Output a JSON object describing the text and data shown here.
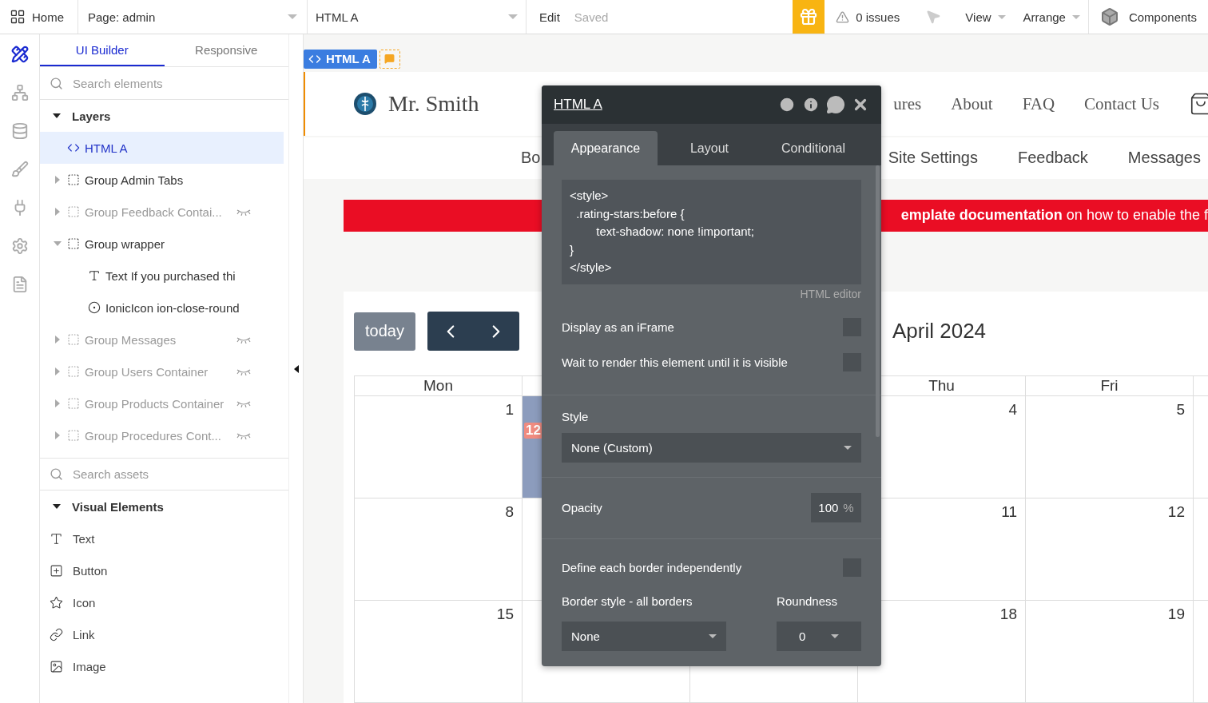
{
  "topbar": {
    "home": "Home",
    "page_selector": "Page: admin",
    "element_selector": "HTML A",
    "edit": "Edit",
    "saved": "Saved",
    "issues": "0 issues",
    "view": "View",
    "arrange": "Arrange",
    "components": "Components"
  },
  "rail": [
    {
      "kind": "design",
      "selected": true
    },
    {
      "kind": "workflow",
      "selected": false
    },
    {
      "kind": "data",
      "selected": false
    },
    {
      "kind": "styles",
      "selected": false
    },
    {
      "kind": "plugins",
      "selected": false
    },
    {
      "kind": "settings",
      "selected": false
    },
    {
      "kind": "logs",
      "selected": false
    }
  ],
  "sidebar": {
    "tabs": [
      {
        "label": "UI Builder",
        "selected": true
      },
      {
        "label": "Responsive",
        "selected": false
      }
    ],
    "search": {
      "placeholder": "Search elements"
    },
    "layers": {
      "title": "Layers",
      "expanded": true,
      "items": [
        {
          "kind": "html",
          "label": "HTML A",
          "selected": true,
          "hidden": false
        },
        {
          "kind": "group",
          "label": "Group Admin Tabs",
          "selected": false,
          "hidden": false,
          "expanded": false
        },
        {
          "kind": "group",
          "label": "Group Feedback Contai...",
          "selected": false,
          "hidden": true,
          "expanded": false
        },
        {
          "kind": "group",
          "label": "Group wrapper",
          "selected": false,
          "hidden": false,
          "expanded": true,
          "children": [
            {
              "kind": "text",
              "label": "Text If you purchased thi",
              "selected": false,
              "hidden": false
            },
            {
              "kind": "icon",
              "label": "IonicIcon ion-close-round",
              "selected": false,
              "hidden": false
            }
          ]
        },
        {
          "kind": "group",
          "label": "Group Messages",
          "selected": false,
          "hidden": true,
          "expanded": false
        },
        {
          "kind": "group",
          "label": "Group Users Container",
          "selected": false,
          "hidden": true,
          "expanded": false
        },
        {
          "kind": "group",
          "label": "Group Products Container",
          "selected": false,
          "hidden": true,
          "expanded": false
        },
        {
          "kind": "group",
          "label": "Group Procedures Cont...",
          "selected": false,
          "hidden": true,
          "expanded": false
        }
      ]
    },
    "asset_search": {
      "placeholder": "Search assets"
    },
    "visual_elements": {
      "title": "Visual Elements",
      "expanded": true,
      "items": [
        {
          "kind": "text",
          "label": "Text"
        },
        {
          "kind": "button",
          "label": "Button"
        },
        {
          "kind": "icon",
          "label": "Icon"
        },
        {
          "kind": "link",
          "label": "Link"
        },
        {
          "kind": "image",
          "label": "Image"
        }
      ]
    }
  },
  "canvas": {
    "element_tag": "HTML A",
    "site": {
      "brand": "Mr. Smith",
      "nav": [
        "ures",
        "About",
        "FAQ",
        "Contact Us"
      ],
      "subnav_left": [
        "Bo"
      ],
      "subnav_right": [
        "Site Settings",
        "Feedback",
        "Messages"
      ],
      "banner": "**emplate documentation** on how to enable the f"
    },
    "calendar": {
      "today": "today",
      "title": "April 2024",
      "headings": {
        "column_1": "Mon",
        "column_4": "Thu",
        "column_5": "Fri"
      },
      "weeks": [
        {
          "column_1": "1",
          "column_2_event": "12",
          "column_4": "4",
          "column_5": "5"
        },
        {
          "column_1": "8",
          "column_4": "11",
          "column_5": "12"
        },
        {
          "column_1": "15",
          "column_4": "18",
          "column_5": "19"
        }
      ]
    }
  },
  "property_editor": {
    "title": "HTML A",
    "tabs": [
      {
        "label": "Appearance",
        "selected": true
      },
      {
        "label": "Layout",
        "selected": false
      },
      {
        "label": "Conditional",
        "selected": false
      }
    ],
    "code": "<style>\n  .rating-stars:before {\n        text-shadow: none !important;\n}\n</style>",
    "code_label": "HTML editor",
    "options": [
      {
        "label": "Display as an iFrame",
        "checked": false
      },
      {
        "label": "Wait to render this element until it is visible",
        "checked": false
      }
    ],
    "style": {
      "label": "Style",
      "value": "None (Custom)"
    },
    "opacity": {
      "label": "Opacity",
      "value": "100",
      "unit": "%"
    },
    "border_independent": {
      "label": "Define each border independently",
      "checked": false
    },
    "border_style": {
      "label": "Border style - all borders",
      "value": "None"
    },
    "roundness": {
      "label": "Roundness",
      "value": "0"
    }
  }
}
